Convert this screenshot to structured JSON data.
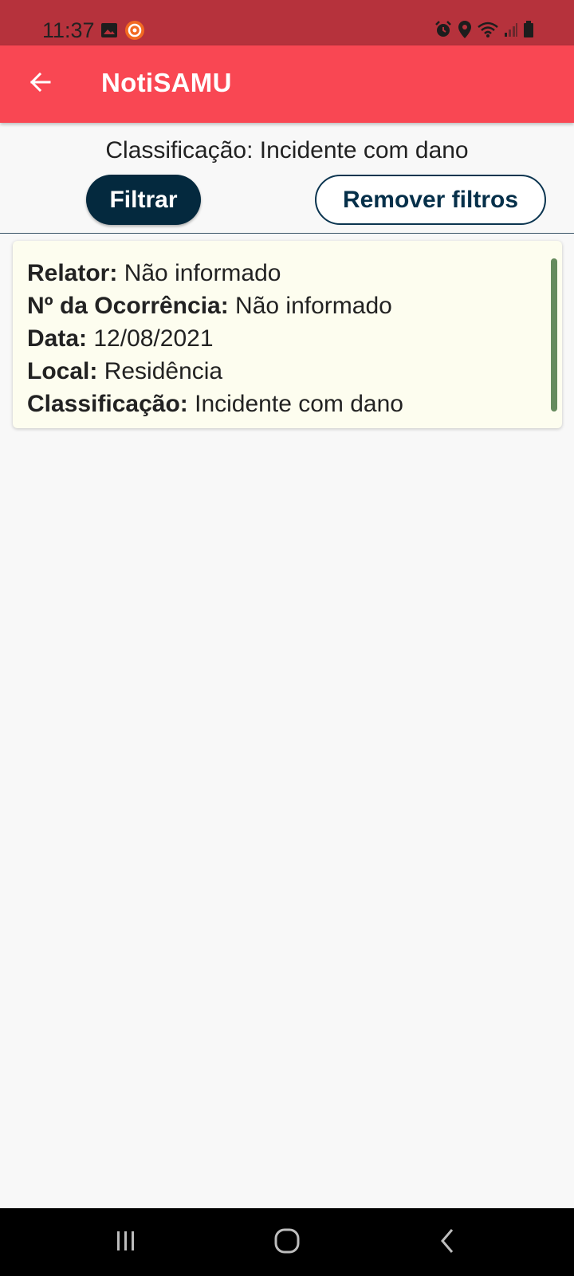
{
  "status_bar": {
    "time": "11:37",
    "icons_left": [
      "image-icon",
      "recorder-icon"
    ],
    "icons_right": [
      "alarm-icon",
      "location-icon",
      "wifi-icon",
      "signal-icon",
      "battery-icon"
    ],
    "color": "#b6323c"
  },
  "app_bar": {
    "title": "NotiSAMU",
    "back_icon": "arrow-left-icon",
    "color": "#f94753"
  },
  "filter": {
    "active_label": "Classificação: Incidente com dano",
    "filter_button": "Filtrar",
    "remove_button": "Remover filtros"
  },
  "cards": [
    {
      "relator_label": "Relator:",
      "relator_value": "Não informado",
      "ocorrencia_label": "Nº da Ocorrência:",
      "ocorrencia_value": "Não informado",
      "data_label": "Data:",
      "data_value": "12/08/2021",
      "local_label": "Local:",
      "local_value": "Residência",
      "classificacao_label": "Classificação:",
      "classificacao_value": "Incidente com dano",
      "accent_color": "#658b5e"
    }
  ],
  "nav_bar": {
    "buttons": [
      "recent-apps-icon",
      "home-icon",
      "back-icon"
    ]
  }
}
